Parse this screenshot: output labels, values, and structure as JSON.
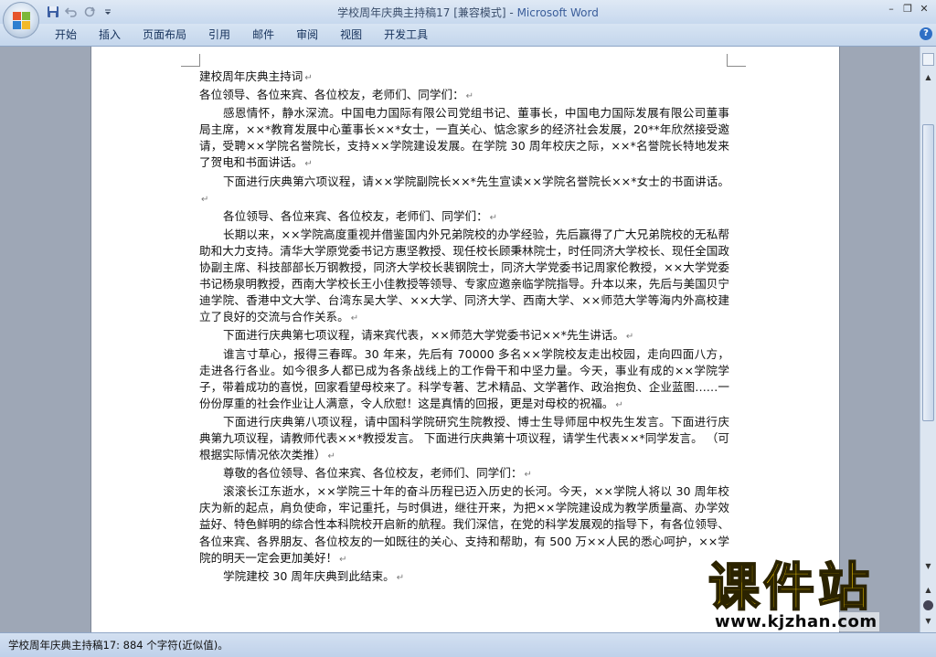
{
  "window": {
    "title_doc": "学校周年庆典主持稿17 [兼容模式] - ",
    "title_app": "Microsoft Word",
    "min": "–",
    "restore": "❐",
    "close": "✕"
  },
  "qat": {
    "icons": [
      "save-icon",
      "undo-icon",
      "redo-icon",
      "customize-icon"
    ]
  },
  "ribbon": {
    "tabs": [
      "开始",
      "插入",
      "页面布局",
      "引用",
      "邮件",
      "审阅",
      "视图",
      "开发工具"
    ],
    "help": "?"
  },
  "document": {
    "paragraphs": [
      {
        "text": "建校周年庆典主持词",
        "indent": false
      },
      {
        "text": "各位领导、各位来宾、各位校友，老师们、同学们：",
        "indent": false
      },
      {
        "text": "感恩情怀，静水深流。中国电力国际有限公司党组书记、董事长，中国电力国际发展有限公司董事局主席，××*教育发展中心董事长××*女士，一直关心、惦念家乡的经济社会发展，20**年欣然接受邀请，受聘××学院名誉院长，支持××学院建设发展。在学院 30 周年校庆之际，××*名誉院长特地发来了贺电和书面讲话。",
        "indent": true
      },
      {
        "text": "下面进行庆典第六项议程，请××学院副院长××*先生宣读××学院名誉院长××*女士的书面讲话。",
        "indent": true
      },
      {
        "text": "各位领导、各位来宾、各位校友，老师们、同学们：",
        "indent": true
      },
      {
        "text": "长期以来，××学院高度重视并借鉴国内外兄弟院校的办学经验，先后赢得了广大兄弟院校的无私帮助和大力支持。清华大学原党委书记方惠坚教授、现任校长顾秉林院士，时任同济大学校长、现任全国政协副主席、科技部部长万钢教授，同济大学校长裴钢院士，同济大学党委书记周家伦教授，××大学党委书记杨泉明教授，西南大学校长王小佳教授等领导、专家应邀亲临学院指导。升本以来，先后与美国贝宁迪学院、香港中文大学、台湾东吴大学、××大学、同济大学、西南大学、××师范大学等海内外高校建立了良好的交流与合作关系。",
        "indent": true
      },
      {
        "text": "下面进行庆典第七项议程，请来宾代表，××师范大学党委书记××*先生讲话。",
        "indent": true
      },
      {
        "text": "谁言寸草心，报得三春晖。30 年来，先后有 70000 多名××学院校友走出校园，走向四面八方，走进各行各业。如今很多人都已成为各条战线上的工作骨干和中坚力量。今天，事业有成的××学院学子，带着成功的喜悦，回家看望母校来了。科学专著、艺术精品、文学著作、政治抱负、企业蓝图……一份份厚重的社会作业让人满意，令人欣慰！这是真情的回报，更是对母校的祝福。",
        "indent": true
      },
      {
        "text": "下面进行庆典第八项议程，请中国科学院研究生院教授、博士生导师屈中权先生发言。下面进行庆典第九项议程，请教师代表××*教授发言。       下面进行庆典第十项议程，请学生代表××*同学发言。  （可根据实际情况依次类推）",
        "indent": true
      },
      {
        "text": "尊敬的各位领导、各位来宾、各位校友，老师们、同学们：",
        "indent": true
      },
      {
        "text": "滚滚长江东逝水，××学院三十年的奋斗历程已迈入历史的长河。今天，××学院人将以 30 周年校庆为新的起点，肩负使命，牢记重托，与时俱进，继往开来，为把××学院建设成为教学质量高、办学效益好、特色鲜明的综合性本科院校开启新的航程。我们深信，在党的科学发展观的指导下，有各位领导、各位来宾、各界朋友、各位校友的一如既往的关心、支持和帮助，有 500 万××人民的悉心呵护，××学院的明天一定会更加美好！",
        "indent": true
      },
      {
        "text": "学院建校 30 周年庆典到此结束。",
        "indent": true
      }
    ],
    "para_mark": "↵"
  },
  "statusbar": {
    "text": "学校周年庆典主持稿17: 884 个字符(近似值)。"
  },
  "watermark": {
    "cn": "课件站",
    "url": "www.kjzhan.com"
  },
  "colors": {
    "titlebar": "#c7d8ee",
    "ribbon": "#c4d6ec",
    "workspace": "#9ea7b6",
    "watermark_fill": "#ffd200"
  }
}
